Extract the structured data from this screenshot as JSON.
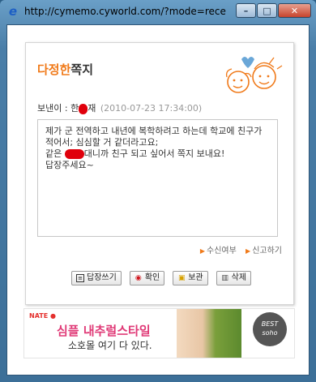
{
  "window": {
    "title": "http://cymemo.cyworld.com/?mode=receive...",
    "minimize_label": "–",
    "maximize_label": "□",
    "close_label": "✕"
  },
  "memo": {
    "brand_colored": "다정한",
    "brand_dark": "쪽지",
    "sender_label": "보낸이 : ",
    "sender_name_start": "한",
    "sender_name_end": "재",
    "date": "(2010-07-23 17:34:00)",
    "message_line1": "제가 군 전역하고 내년에 복학하려고 하는데 학교에 친구가 적어서; 심심할 거 같더라고요;",
    "message_line2_before": "같은 ",
    "message_line2_after": "대니까 친구 되고 싶어서 쪽지 보내요!",
    "message_line3": "답장주세요~"
  },
  "links": {
    "receipt": "수신여부",
    "report": "신고하기"
  },
  "buttons": {
    "reply": "답장쓰기",
    "confirm": "확인",
    "save": "보관",
    "delete": "삭제"
  },
  "ad": {
    "logo": "NATE",
    "headline": "심플 내추럴스타일",
    "subline": "소호몰 여기 다 있다.",
    "badge_line1": "BEST",
    "badge_line2": "soho"
  },
  "colors": {
    "accent_orange": "#f07a1a",
    "redaction": "#e0000c",
    "ad_pink": "#e03a77"
  }
}
